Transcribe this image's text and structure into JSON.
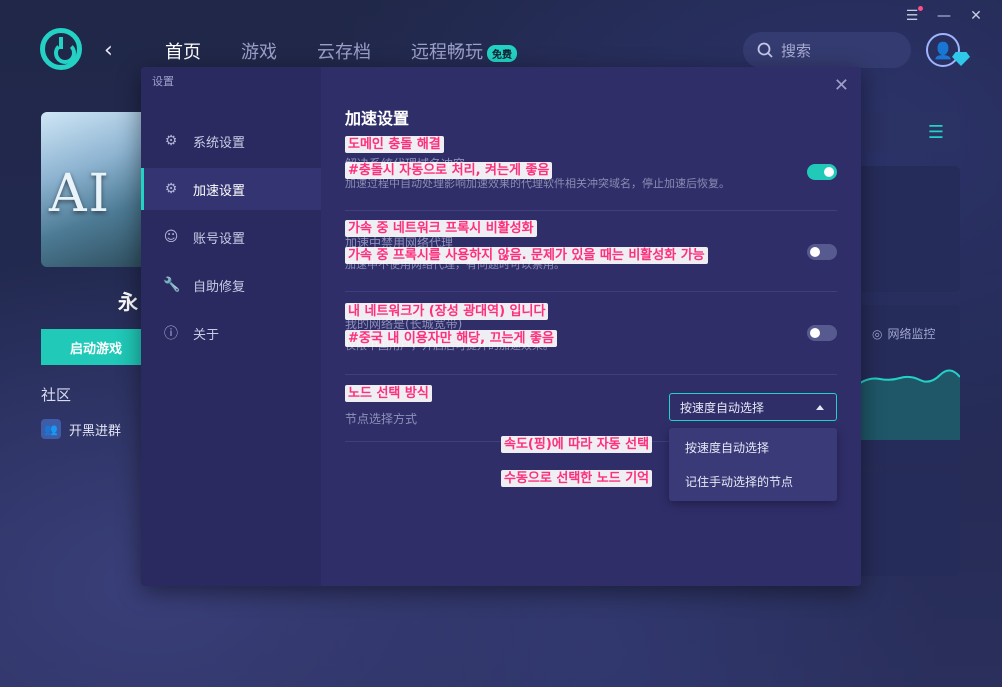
{
  "window_controls": {
    "menu": "☰",
    "minimize": "—",
    "close": "✕"
  },
  "topbar": {
    "nav": [
      {
        "label": "首页",
        "active": true
      },
      {
        "label": "游戏",
        "active": false
      },
      {
        "label": "云存档",
        "active": false
      },
      {
        "label": "远程畅玩",
        "active": false,
        "badge": "免费"
      }
    ],
    "search_placeholder": "搜索"
  },
  "game": {
    "title_partial": "永",
    "cover_text": "AI",
    "start_button": "启动游戏",
    "community_label": "社区",
    "join_group": "开黑进群"
  },
  "right_panel": {
    "network_monitor": "网络监控"
  },
  "settings": {
    "window_title": "设置",
    "menu": [
      {
        "label": "系统设置",
        "icon": "gear-icon",
        "active": false
      },
      {
        "label": "加速设置",
        "icon": "gear-settings-icon",
        "active": true
      },
      {
        "label": "账号设置",
        "icon": "user-icon",
        "active": false
      },
      {
        "label": "自助修复",
        "icon": "wrench-icon",
        "active": false
      },
      {
        "label": "关于",
        "icon": "info-icon",
        "active": false
      }
    ],
    "section_title": "加速设置",
    "rows": [
      {
        "label": "解决系统代理域名冲突",
        "desc": "加速过程中自动处理影响加速效果的代理软件相关冲突域名，停止加速后恢复。",
        "toggle": true,
        "overlay_title": "도메인 충돌 해결",
        "overlay_note": "#충돌시 자동으로 처리, 켜는게 좋음"
      },
      {
        "label": "加速中禁用网络代理",
        "desc": "加速中不使用网络代理，有问题时可以禁用。",
        "toggle": false,
        "overlay_title": "가속 중 네트워크 프록시 비활성화",
        "overlay_note": "가속 중 프록시를 사용하지 않음. 문제가 있을 때는 비활성화 가능"
      },
      {
        "label": "我的网络是(长城宽带)",
        "desc": "仅限中国用户，开启后可提升的加速效果。",
        "toggle": false,
        "overlay_title": "내 네트워크가 (장성 광대역) 입니다",
        "overlay_note": "#중국 내 이용자만 해당, 끄는게 좋음"
      }
    ],
    "node_select": {
      "label": "节点选择方式",
      "overlay_title": "노드 선택 방식",
      "selected": "按速度自动选择",
      "options": [
        {
          "label": "按速度自动选择",
          "overlay": "속도(핑)에 따라 자동 선택"
        },
        {
          "label": "记住手动选择的节点",
          "overlay": "수동으로 선택한 노드 기억"
        }
      ]
    }
  },
  "colors": {
    "accent": "#23d2c4",
    "overlay_text": "#ff2f7c",
    "modal_bg": "#302e69"
  }
}
